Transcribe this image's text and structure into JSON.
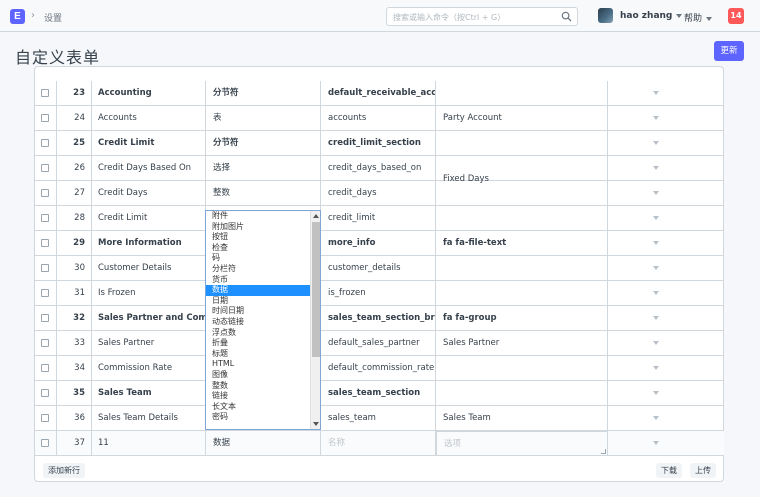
{
  "navbar": {
    "logo": "E",
    "breadcrumb": "设置",
    "search_placeholder": "搜索或输入命令（按Ctrl + G）",
    "user": "hao zhang",
    "help": "帮助",
    "notifications": "14"
  },
  "page": {
    "title": "自定义表单",
    "update_button": "更新"
  },
  "rows": [
    {
      "idx": "23",
      "label": "Accounting",
      "type": "分节符",
      "name": "default_receivable_accounts",
      "options": "",
      "bold": true
    },
    {
      "idx": "24",
      "label": "Accounts",
      "type": "表",
      "name": "accounts",
      "options": "Party Account",
      "bold": false
    },
    {
      "idx": "25",
      "label": "Credit Limit",
      "type": "分节符",
      "name": "credit_limit_section",
      "options": "",
      "bold": true
    },
    {
      "idx": "26",
      "label": "Credit Days Based On",
      "type": "选择",
      "name": "credit_days_based_on",
      "options": "",
      "bold": false
    },
    {
      "idx": "27",
      "label": "Credit Days",
      "type": "整数",
      "name": "credit_days",
      "options": "",
      "bold": false
    },
    {
      "idx": "28",
      "label": "Credit Limit",
      "type": "",
      "name": "credit_limit",
      "options": "",
      "bold": false
    },
    {
      "idx": "29",
      "label": "More Information",
      "type": "",
      "name": "more_info",
      "options": "fa fa-file-text",
      "bold": true
    },
    {
      "idx": "30",
      "label": "Customer Details",
      "type": "",
      "name": "customer_details",
      "options": "",
      "bold": false
    },
    {
      "idx": "31",
      "label": "Is Frozen",
      "type": "",
      "name": "is_frozen",
      "options": "",
      "bold": false
    },
    {
      "idx": "32",
      "label": "Sales Partner and Commis...",
      "type": "",
      "name": "sales_team_section_break",
      "options": "fa fa-group",
      "bold": true
    },
    {
      "idx": "33",
      "label": "Sales Partner",
      "type": "",
      "name": "default_sales_partner",
      "options": "Sales Partner",
      "bold": false
    },
    {
      "idx": "34",
      "label": "Commission Rate",
      "type": "",
      "name": "default_commission_rate",
      "options": "",
      "bold": false
    },
    {
      "idx": "35",
      "label": "Sales Team",
      "type": "",
      "name": "sales_team_section",
      "options": "",
      "bold": true
    },
    {
      "idx": "36",
      "label": "Sales Team Details",
      "type": "",
      "name": "sales_team",
      "options": "Sales Team",
      "bold": false
    }
  ],
  "credit_days_options_overflow": "Fixed Days",
  "new_row": {
    "idx": "37",
    "label": "11",
    "type": "数据",
    "name_placeholder": "名称",
    "options_placeholder": "选项"
  },
  "fieldtype_options": [
    "附件",
    "附加图片",
    "按钮",
    "检查",
    "码",
    "分栏符",
    "货币",
    "数据",
    "日期",
    "时间日期",
    "动态链接",
    "浮点数",
    "折叠",
    "标题",
    "HTML",
    "图像",
    "整数",
    "链接",
    "长文本",
    "密码"
  ],
  "selected_option": "数据",
  "footer": {
    "add_row": "添加新行",
    "download": "下载",
    "upload": "上传"
  },
  "colors": {
    "accent": "#5e64ff",
    "badge": "#ff5858",
    "selection": "#1e90ff"
  }
}
